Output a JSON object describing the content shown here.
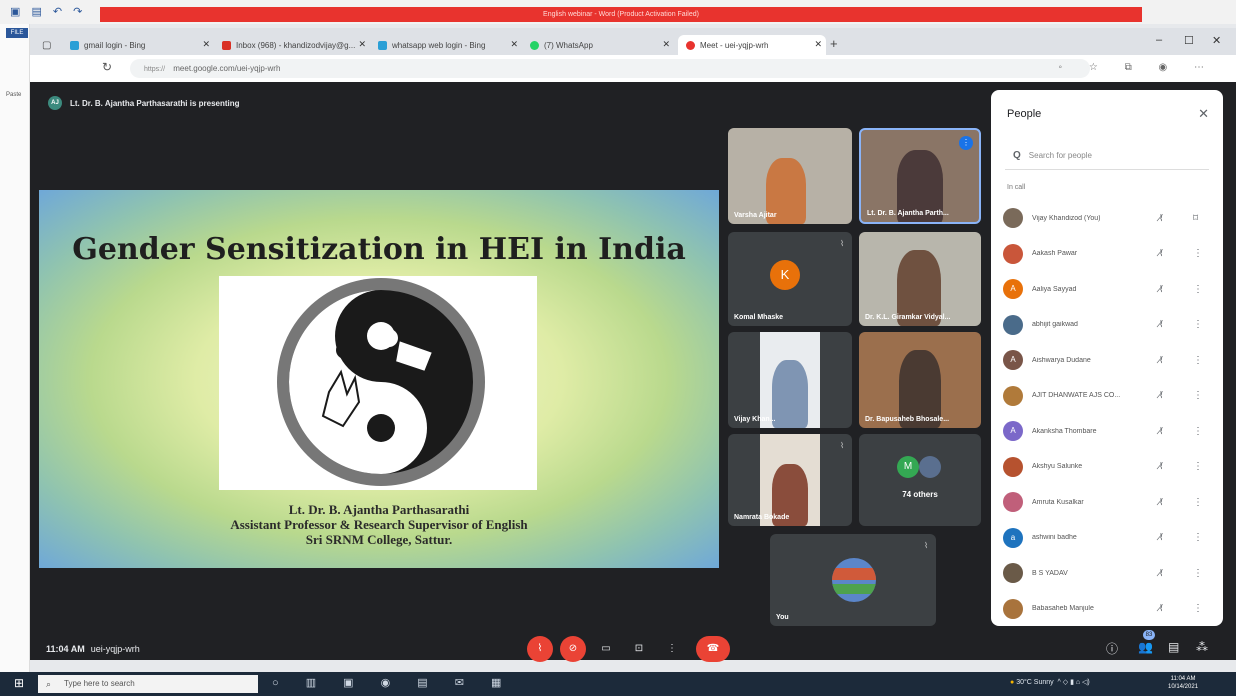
{
  "word": {
    "title": "English webinar - Word (Product Activation Failed)",
    "file_tab": "FILE",
    "paste_label": "Paste"
  },
  "browser": {
    "tabs": [
      {
        "label": "gmail login - Bing",
        "icon": "bing-icon"
      },
      {
        "label": "Inbox (968) - khandizodvijay@g...",
        "icon": "gmail-icon"
      },
      {
        "label": "whatsapp web login - Bing",
        "icon": "bing-icon"
      },
      {
        "label": "(7) WhatsApp",
        "icon": "whatsapp-icon"
      },
      {
        "label": "Meet - uei-yqjp-wrh",
        "icon": "meet-icon"
      }
    ],
    "url": "meet.google.com/uei-yqjp-wrh",
    "url_prefix": "https://"
  },
  "meet": {
    "presenting_initials": "AJ",
    "presenting_text": "Lt. Dr. B. Ajantha Parthasarathi is presenting",
    "slide": {
      "title": "Gender Sensitization in HEI in India",
      "credit_line1": "Lt. Dr. B. Ajantha Parthasarathi",
      "credit_line2": "Assistant Professor & Research Supervisor of English",
      "credit_line3": "Sri SRNM College, Sattur."
    },
    "tiles": {
      "varsha": "Varsha Ajitar",
      "ajantha": "Lt. Dr. B. Ajantha Parth...",
      "komal_initial": "K",
      "komal": "Komal Mhaske",
      "giramkar": "Dr. K.L. Giramkar Vidyal...",
      "vijay": "Vijay Khan...",
      "bapusaheb": "Dr. Bapusaheb Bhosale...",
      "namrata": "Namrata Bokade",
      "others_initial": "M",
      "others": "74 others",
      "you": "You"
    },
    "time": "11:04 AM",
    "meeting_code": "uei-yqjp-wrh",
    "participant_count": "83"
  },
  "people_panel": {
    "title": "People",
    "search_placeholder": "Search for people",
    "section": "In call",
    "participants": [
      {
        "name": "Vijay Khandizod (You)",
        "initial": "",
        "color": "#7a6a5a"
      },
      {
        "name": "Aakash Pawar",
        "initial": "",
        "color": "#c9563a"
      },
      {
        "name": "Aaliya Sayyad",
        "initial": "A",
        "color": "#e8710a"
      },
      {
        "name": "abhijit gaikwad",
        "initial": "",
        "color": "#4a6b8a"
      },
      {
        "name": "Aishwarya Dudane",
        "initial": "A",
        "color": "#795548"
      },
      {
        "name": "AJIT DHANWATE AJS CO...",
        "initial": "",
        "color": "#b07a3a"
      },
      {
        "name": "Akanksha Thombare",
        "initial": "A",
        "color": "#7b68c9"
      },
      {
        "name": "Akshyu Salunke",
        "initial": "",
        "color": "#b6522f"
      },
      {
        "name": "Amruta Kusalkar",
        "initial": "",
        "color": "#c05f7a"
      },
      {
        "name": "ashwini badhe",
        "initial": "a",
        "color": "#1e73be"
      },
      {
        "name": "B S YADAV",
        "initial": "",
        "color": "#6a5a48"
      },
      {
        "name": "Babasaheb Manjule",
        "initial": "",
        "color": "#a8733c"
      }
    ]
  },
  "taskbar": {
    "search_placeholder": "Type here to search",
    "weather": "30°C Sunny",
    "clock_time": "11:04 AM",
    "clock_date": "10/14/2021"
  }
}
